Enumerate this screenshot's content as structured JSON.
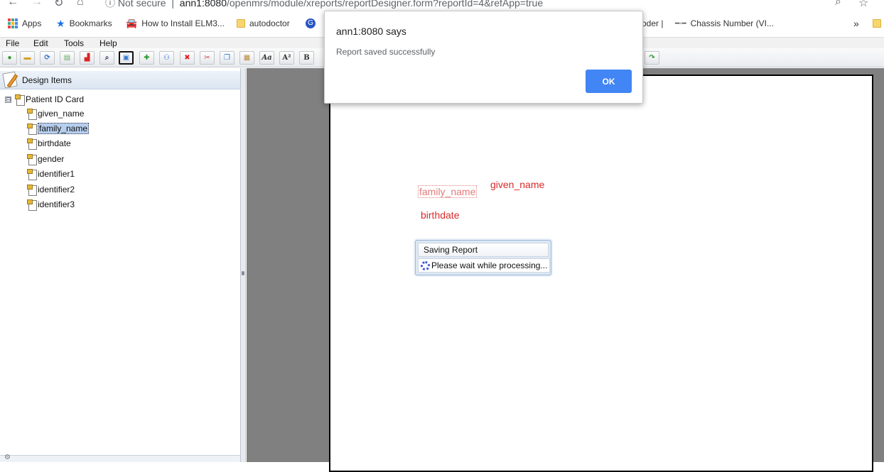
{
  "browser": {
    "security_label": "Not secure",
    "url_host": "ann1:8080",
    "url_path": "/openmrs/module/xreports/reportDesigner.form?reportId=4&refApp=true"
  },
  "bookmarks": [
    {
      "label": "Apps",
      "icon": "apps-grid-icon"
    },
    {
      "label": "Bookmarks",
      "icon": "star-icon"
    },
    {
      "label": "How to Install ELM3...",
      "icon": "car-icon"
    },
    {
      "label": "autodoctor",
      "icon": "folder-icon"
    },
    {
      "label": "oder |",
      "icon": ""
    },
    {
      "label": "Chassis Number (VI...",
      "icon": "car-logo-icon"
    }
  ],
  "menubar": [
    "File",
    "Edit",
    "Tools",
    "Help"
  ],
  "left_panel": {
    "title": "Design Items",
    "root": "Patient ID Card",
    "root_toggle": "⊟",
    "items": [
      "given_name",
      "family_name",
      "birthdate",
      "gender",
      "identifier1",
      "identifier2",
      "identifier3"
    ],
    "selected_item": "family_name"
  },
  "report": {
    "fields": {
      "family_name": "family_name",
      "given_name": "given_name",
      "birthdate": "birthdate"
    },
    "field_color": "#d92a2a"
  },
  "saving_popup": {
    "title": "Saving Report",
    "message": "Please wait while processing..."
  },
  "alert": {
    "title": "ann1:8080 says",
    "message": "Report saved successfully",
    "ok_label": "OK",
    "button_color": "#4285f4"
  },
  "toolbar_text_buttons": {
    "italic": "Aa",
    "superscript": "A²",
    "bold": "B"
  }
}
